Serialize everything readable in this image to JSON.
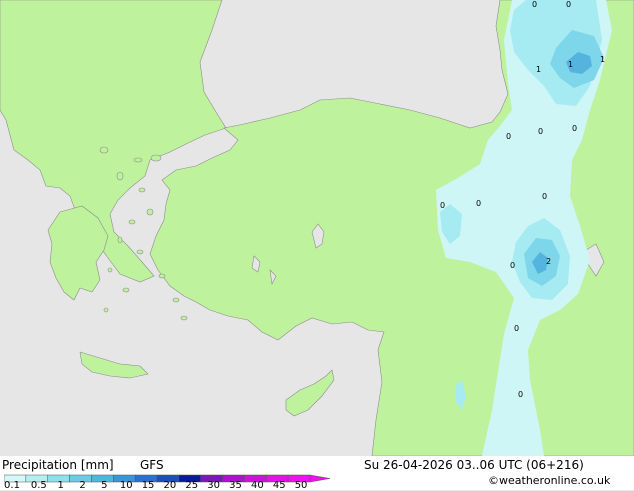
{
  "footer": {
    "title": "Precipitation [mm]",
    "model": "GFS",
    "datetime": "Su 26-04-2026 03..06 UTC (06+216)",
    "credit": "©weatheronline.co.uk"
  },
  "legend": {
    "ticks": [
      "0.1",
      "0.5",
      "1",
      "2",
      "5",
      "10",
      "15",
      "20",
      "25",
      "30",
      "35",
      "40",
      "45",
      "50"
    ],
    "colors": [
      "#d4f7f7",
      "#b4eef2",
      "#8ee0ea",
      "#6ccbe4",
      "#4fb6dd",
      "#3a96d6",
      "#2a72cc",
      "#1b4fbc",
      "#0a1a9c",
      "#7a18b8",
      "#a716c8",
      "#cc14d8",
      "#e412e4",
      "#f010f0"
    ]
  },
  "map_colors": {
    "sea": "#e6e6e6",
    "land": "#bff29d",
    "precip_light": "#cff6f6",
    "precip_mid": "#a6ebf2",
    "precip_heavy": "#7dd6ea",
    "precip_core": "#54b4dd"
  },
  "map_labels": [
    "0",
    "1",
    "1",
    "1",
    "0",
    "0",
    "0",
    "0",
    "0",
    "0",
    "0",
    "2",
    "0",
    "0",
    "0"
  ]
}
